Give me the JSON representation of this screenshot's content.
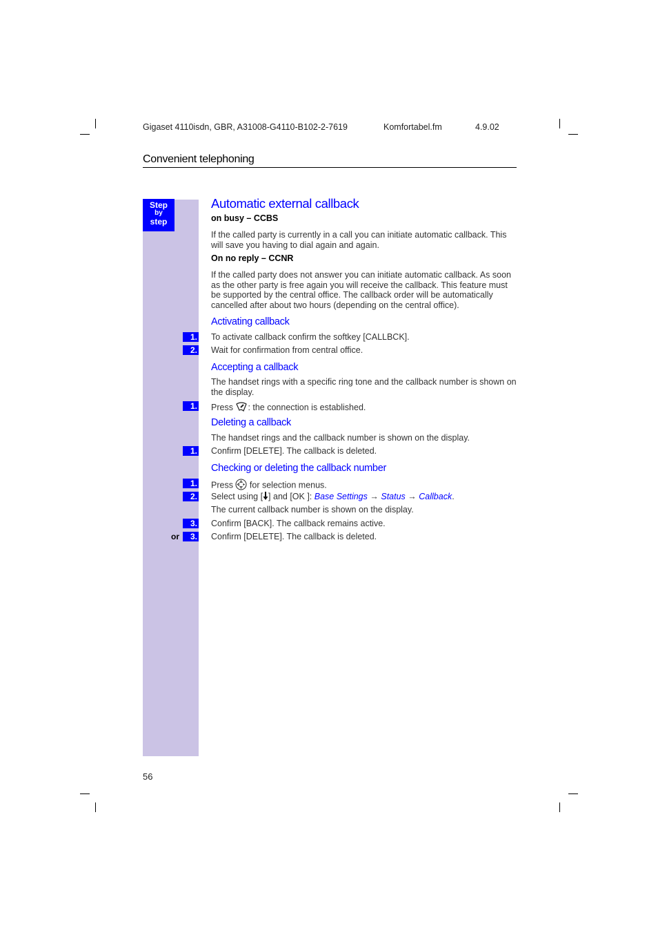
{
  "header": {
    "doc_id": "Gigaset 4110isdn, GBR, A31008-G4110-B102-2-7619",
    "file": "Komfortabel.fm",
    "date": "4.9.02"
  },
  "section_title": "Convenient telephoning",
  "step_badge": {
    "line1": "Step",
    "line2": "by",
    "line3": "step"
  },
  "main": {
    "title": "Automatic external callback",
    "busy_heading": "on busy – CCBS",
    "busy_text": "If the called party is currently in a call you can initiate automatic callback. This will save you having to dial again and again.",
    "noreply_heading": "On no reply – CCNR",
    "noreply_text": "If the called party does not answer you can initiate automatic callback. As soon as the other party is free again you will receive the callback. This feature must be supported by the central office. The callback order will be automatically cancelled after about two hours (depending on the central office).",
    "activating": {
      "heading": "Activating callback",
      "steps": [
        {
          "num": "1.",
          "text": "To activate callback confirm the softkey [CALLBCK]."
        },
        {
          "num": "2.",
          "text": "Wait for confirmation from central office."
        }
      ]
    },
    "accepting": {
      "heading": "Accepting a callback",
      "text": "The handset rings with a specific ring tone and the callback number is shown on the display.",
      "step_num": "1.",
      "step_prefix": "Press",
      "step_icon": "talk-key-icon",
      "step_suffix": ": the connection is established."
    },
    "deleting": {
      "heading": "Deleting a callback",
      "text": "The handset rings and the callback number is shown on the display.",
      "steps": [
        {
          "num": "1.",
          "text": "Confirm [DELETE]. The callback is deleted."
        }
      ]
    },
    "checking": {
      "heading": "Checking or deleting the callback number",
      "step1_num": "1.",
      "step1_prefix": "Press",
      "step1_icon": "control-key-icon",
      "step1_suffix": "for selection menus.",
      "step2_num": "2.",
      "step2_prefix": "Select using [",
      "step2_icon": "down-arrow-icon",
      "step2_mid": "] and [OK ]: ",
      "menu_path": [
        "Base Settings",
        "Status",
        "Callback"
      ],
      "arrow": "→",
      "step2_end": ".",
      "info": "The current callback number is shown on the display.",
      "step3_num": "3.",
      "step3_text": "Confirm [BACK]. The callback remains active.",
      "or_label": "or",
      "step3b_num": "3.",
      "step3b_text": "Confirm [DELETE]. The callback is deleted."
    }
  },
  "page_number": "56"
}
